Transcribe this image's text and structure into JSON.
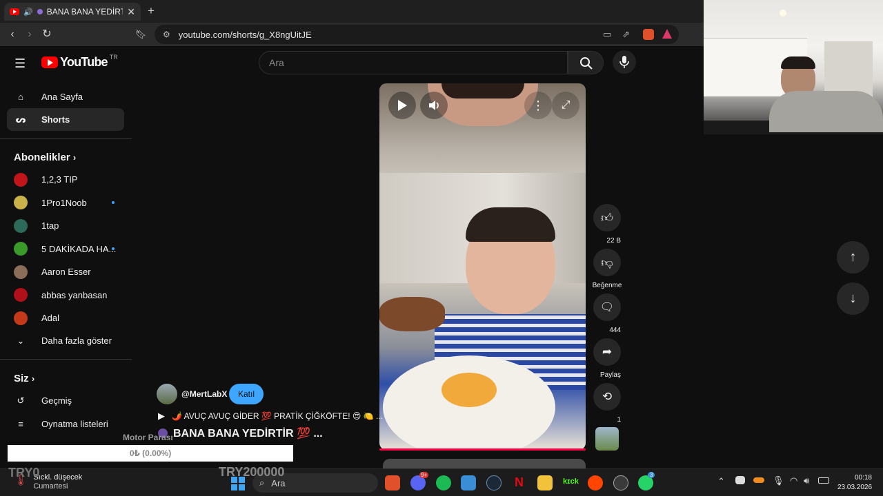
{
  "browser": {
    "tab_title": "BANA BANA YEDİRTİR",
    "tab_emoji": "💯",
    "new_tab": "+",
    "url": "youtube.com/shorts/g_X8ngUitJE"
  },
  "header": {
    "logo": "YouTube",
    "country": "TR",
    "search_placeholder": "Ara"
  },
  "sidebar": {
    "home": "Ana Sayfa",
    "shorts": "Shorts",
    "subscriptions_title": "Abonelikler",
    "subscriptions": [
      {
        "label": "1,2,3 TIP",
        "color": "#c0151a",
        "dot": false
      },
      {
        "label": "1Pro1Noob",
        "color": "#c9b24a",
        "dot": true
      },
      {
        "label": "1tap",
        "color": "#2e6a5a",
        "dot": false
      },
      {
        "label": "5 DAKİKADA HA...",
        "color": "#3a9a2a",
        "dot": true
      },
      {
        "label": "Aaron Esser",
        "color": "#8a6e5a",
        "dot": false
      },
      {
        "label": "abbas yanbasan",
        "color": "#b0101a",
        "dot": false
      },
      {
        "label": "Adal",
        "color": "#c23a1a",
        "dot": false
      }
    ],
    "show_more": "Daha fazla göster",
    "you_title": "Siz",
    "history": "Geçmiş",
    "playlists": "Oynatma listeleri"
  },
  "short": {
    "channel": "@MertLabX",
    "join": "Katıl",
    "description": "🌶️ AVUÇ AVUÇ GİDER 💯 PRATİK ÇİĞKÖFTE! 😍 🍋 ...",
    "title": "BANA BANA YEDİRTİR 💯 ..."
  },
  "actions": {
    "likes": "22 B",
    "dislike": "Beğenme",
    "comments": "444",
    "share": "Paylaş",
    "remix": "1"
  },
  "overlay": {
    "motor_label": "Motor Parası",
    "motor_value": "0₺ (0.00%)",
    "try_left": "TRY0",
    "try_right": "TRY200000"
  },
  "taskbar": {
    "weather_title": "Sıckl. düşecek",
    "weather_day": "Cumartesi",
    "search": "Ara",
    "discord_badge": "9+",
    "whatsapp_badge": "3",
    "time": "00:18",
    "date": "23.03.2026"
  },
  "colors": {
    "accent_blue": "#3ea6ff",
    "youtube_red": "#ff0000",
    "progress": "#ff0044"
  }
}
